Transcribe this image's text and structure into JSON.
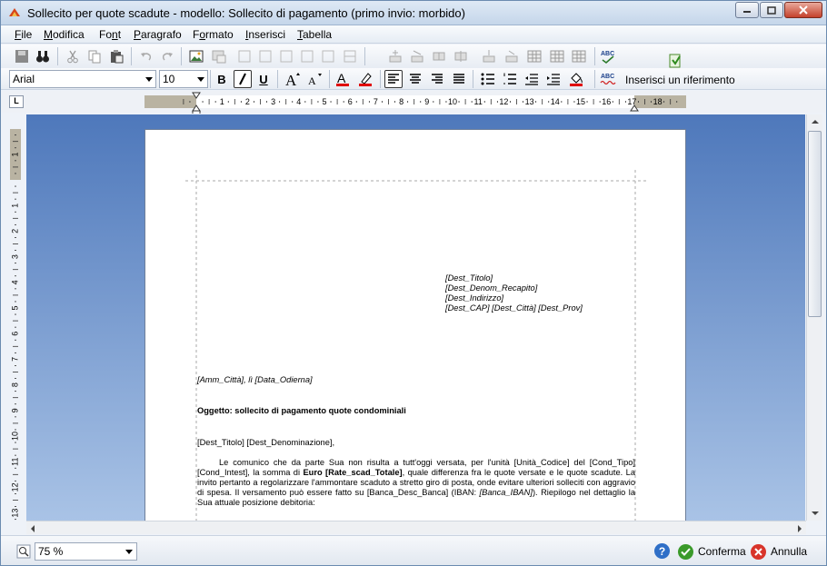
{
  "window": {
    "title": "Sollecito per quote scadute - modello: Sollecito di pagamento (primo invio: morbido)"
  },
  "menu": [
    {
      "label": "File",
      "accel": "F",
      "rest": "ile"
    },
    {
      "label": "Modifica",
      "accel": "M",
      "rest": "odifica"
    },
    {
      "label": "Font",
      "accel": "F",
      "rest": "ont"
    },
    {
      "label": "Paragrafo",
      "accel": "P",
      "rest": "aragrafo"
    },
    {
      "label": "Formato",
      "accel": "F",
      "rest": "ormato"
    },
    {
      "label": "Inserisci",
      "accel": "I",
      "rest": "nserisci"
    },
    {
      "label": "Tabella",
      "accel": "T",
      "rest": "abella"
    }
  ],
  "toolbar": {
    "font_name": "Arial",
    "font_size": "10",
    "bold_label": "B",
    "italic_label": "I",
    "underline_label": "U",
    "spell_label": "ABC",
    "insert_reference_label": "Inserisci un riferimento"
  },
  "ruler": {
    "h_ticks": [
      "1",
      "2",
      "3",
      "4",
      "5",
      "6",
      "7",
      "8",
      "9",
      "10",
      "11",
      "12",
      "13",
      "14",
      "15",
      "16",
      "17",
      "18"
    ],
    "v_ticks": [
      "1",
      "1",
      "2",
      "3",
      "4",
      "5",
      "6",
      "7",
      "8",
      "9",
      "10",
      "11",
      "12",
      "13"
    ],
    "corner_label": "L"
  },
  "document": {
    "recipient": [
      "[Dest_Titolo]",
      "[Dest_Denom_Recapito]",
      "[Dest_Indirizzo]",
      "[Dest_CAP] [Dest_Città] [Dest_Prov]"
    ],
    "place_date": "[Amm_Città], lì [Data_Odierna]",
    "subject": "Oggetto: sollecito di pagamento quote condominiali",
    "greeting": "[Dest_Titolo] [Dest_Denominazione],",
    "body_part1": "Le comunico che da parte Sua non risulta a tutt'oggi versata, per l'unità [Unità_Codice] del [Cond_Tipo] [Cond_Intest], la somma di ",
    "body_bold": "Euro [Rate_scad_Totale]",
    "body_part2": ", quale differenza fra le quote versate e le quote scadute. La invito pertanto a regolarizzare l'ammontare scaduto a stretto giro di posta, onde evitare ulteriori solleciti con aggravio di spesa. Il versamento può essere fatto su [Banca_Desc_Banca] (IBAN: ",
    "body_italic": "[Banca_IBAN]",
    "body_part3": "). Riepilogo nel dettaglio la Sua attuale posizione debitoria:"
  },
  "status": {
    "zoom": "75 %",
    "confirm_label": "Conferma",
    "cancel_label": "Annulla"
  }
}
